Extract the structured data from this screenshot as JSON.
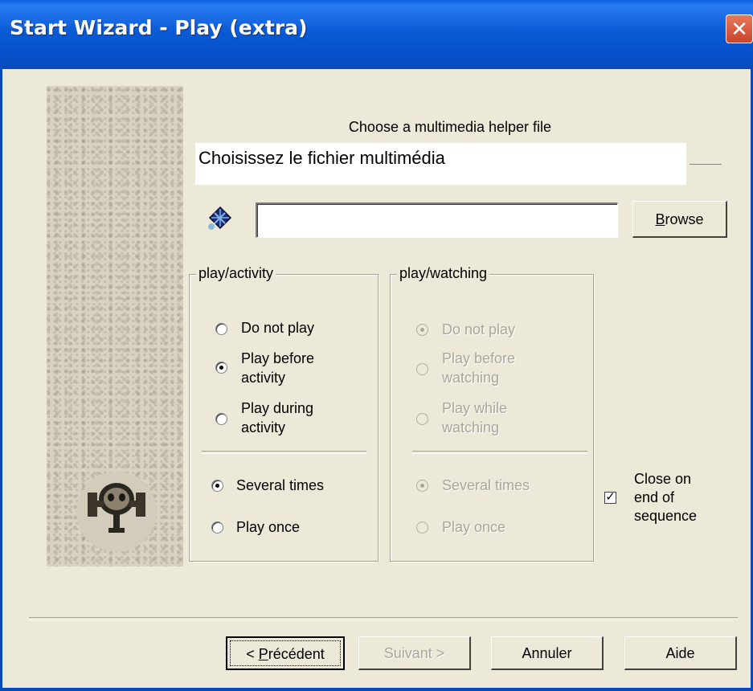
{
  "window": {
    "title": "Start Wizard - Play (extra)",
    "close_glyph": "✕"
  },
  "header": {
    "choose_label": "Choose a multimedia helper file",
    "french_prompt": "Choisissez le fichier multimédia"
  },
  "file": {
    "value": "",
    "icon": "multimedia-file-icon",
    "browse_label": "rowse",
    "browse_accesskey": "B"
  },
  "activity": {
    "title": "play/activity",
    "options": [
      {
        "label": "Do not play",
        "selected": false
      },
      {
        "label": "Play before activity",
        "selected": true
      },
      {
        "label": "Play during activity",
        "selected": false
      }
    ],
    "repeat": [
      {
        "label": "Several times",
        "selected": true
      },
      {
        "label": "Play once",
        "selected": false
      }
    ]
  },
  "watching": {
    "title": "play/watching",
    "disabled": true,
    "options": [
      {
        "label": "Do not play",
        "selected": true
      },
      {
        "label": "Play before watching",
        "selected": false
      },
      {
        "label": "Play while watching",
        "selected": false
      }
    ],
    "repeat": [
      {
        "label": "Several times",
        "selected": true
      },
      {
        "label": "Play once",
        "selected": false
      }
    ]
  },
  "close_on_end": {
    "label": "Close on end of sequence",
    "checked": true
  },
  "buttons": {
    "prev_prefix": "< ",
    "prev_accesskey": "P",
    "prev_rest": "récédent",
    "next_label": "Suivant >",
    "cancel_label": "Annuler",
    "help_label": "Aide"
  },
  "colors": {
    "titlebar": "#0a5fe0",
    "dialog_bg": "#ece9d8",
    "disabled_text": "#a8a69a"
  }
}
